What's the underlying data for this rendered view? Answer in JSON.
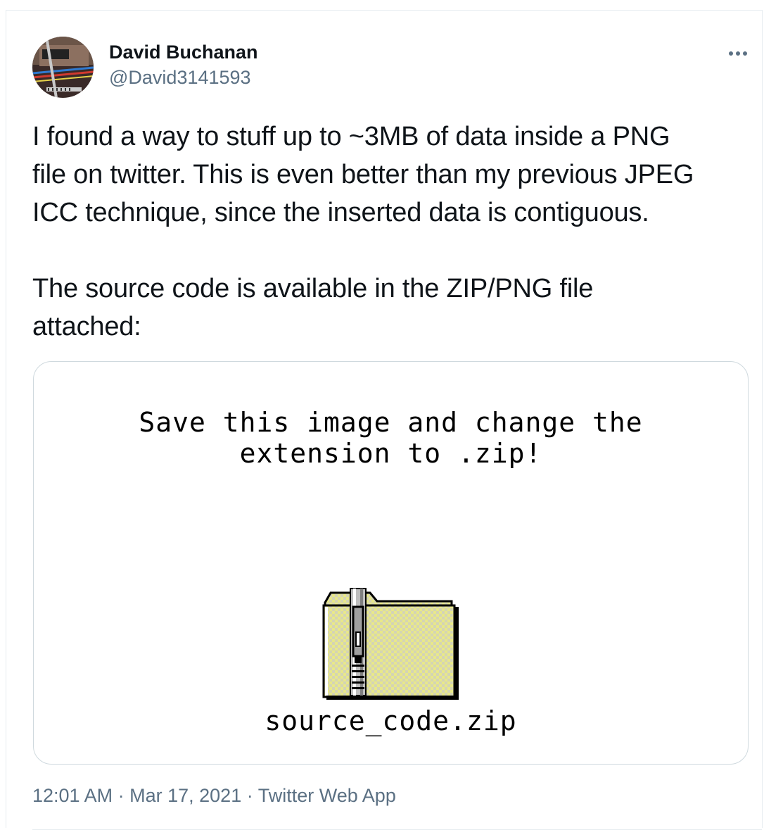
{
  "author": {
    "name": "David Buchanan",
    "handle": "@David3141593"
  },
  "more_icon": "more-dots-icon",
  "tweet": {
    "paragraph_1": "I found a way to stuff up to ~3MB of data inside a PNG\nfile on twitter. This is even better than my previous JPEG\nICC technique, since the inserted data is contiguous.",
    "paragraph_2": "The source code is available in the ZIP/PNG file\nattached:"
  },
  "media": {
    "caption": "Save this image and change the\nextension to .zip!",
    "icon": "zip-folder-icon",
    "filename": "source_code.zip"
  },
  "meta": {
    "time": "12:01 AM",
    "separator": "·",
    "date": "Mar 17, 2021",
    "source": "Twitter Web App"
  },
  "colors": {
    "text": "#0f1419",
    "secondary": "#5b7083",
    "border": "#cfd9de",
    "folder_yellow": "#e8e88a"
  }
}
